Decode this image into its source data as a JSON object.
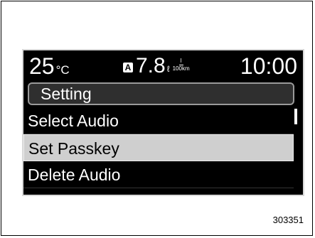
{
  "status": {
    "temperature": "25",
    "temp_unit": "°C",
    "fuel_badge": "A",
    "fuel_value": "7.8",
    "fuel_unit_top": "l",
    "fuel_unit_bottom": "100km",
    "fuel_unit_symbol": "ℓ",
    "time": "10:00"
  },
  "menu": {
    "title": "Setting",
    "items": [
      {
        "label": "Select Audio"
      },
      {
        "label": "Set Passkey"
      },
      {
        "label": "Delete Audio"
      }
    ],
    "selected_index": 1
  },
  "figure_code": "303351"
}
